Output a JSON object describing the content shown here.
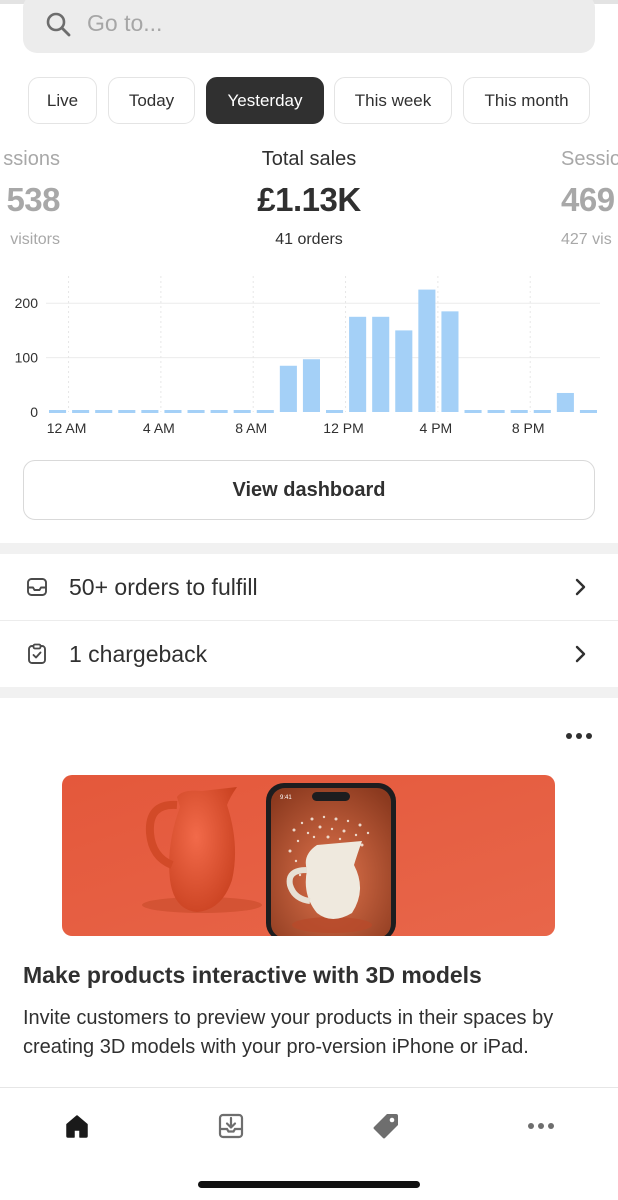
{
  "search": {
    "placeholder": "Go to..."
  },
  "filters": [
    {
      "label": "Live",
      "active": false
    },
    {
      "label": "Today",
      "active": false
    },
    {
      "label": "Yesterday",
      "active": true
    },
    {
      "label": "This week",
      "active": false
    },
    {
      "label": "This month",
      "active": false
    }
  ],
  "metrics": {
    "left": {
      "label": "ssions",
      "value": "538",
      "sub": "visitors"
    },
    "center": {
      "label": "Total sales",
      "value": "£1.13K",
      "sub": "41 orders"
    },
    "right": {
      "label": "Sessio",
      "value": "469",
      "sub": "427 vis"
    }
  },
  "chart_data": {
    "type": "bar",
    "x_tick_labels": [
      "12 AM",
      "4 AM",
      "8 AM",
      "12 PM",
      "4 PM",
      "8 PM"
    ],
    "y_tick_labels": [
      "0",
      "100",
      "200"
    ],
    "ylim": [
      0,
      250
    ],
    "bar_color": "#a4d0f7",
    "hours": [
      0,
      1,
      2,
      3,
      4,
      5,
      6,
      7,
      8,
      9,
      10,
      11,
      12,
      13,
      14,
      15,
      16,
      17,
      18,
      19,
      20,
      21,
      22,
      23
    ],
    "values": [
      0,
      0,
      0,
      0,
      0,
      0,
      0,
      0,
      0,
      0,
      85,
      97,
      0,
      175,
      175,
      150,
      225,
      185,
      0,
      0,
      0,
      0,
      35,
      0
    ]
  },
  "dashboard_button": "View dashboard",
  "tasks": [
    {
      "label": "50+ orders to fulfill",
      "icon": "inbox-icon"
    },
    {
      "label": "1 chargeback",
      "icon": "clipboard-check-icon"
    }
  ],
  "promo": {
    "title": "Make products interactive with 3D models",
    "description": "Invite customers to preview your products in their spaces by creating 3D models with your pro-version iPhone or iPad.",
    "banner_phone_time": "9:41"
  },
  "bottom_nav": [
    {
      "name": "home-icon",
      "active": true
    },
    {
      "name": "orders-icon",
      "active": false
    },
    {
      "name": "products-icon",
      "active": false
    },
    {
      "name": "more-icon",
      "active": false
    }
  ],
  "colors": {
    "accent_dark": "#303030",
    "bar": "#a4d0f7",
    "banner_bg": "#e1583a"
  }
}
